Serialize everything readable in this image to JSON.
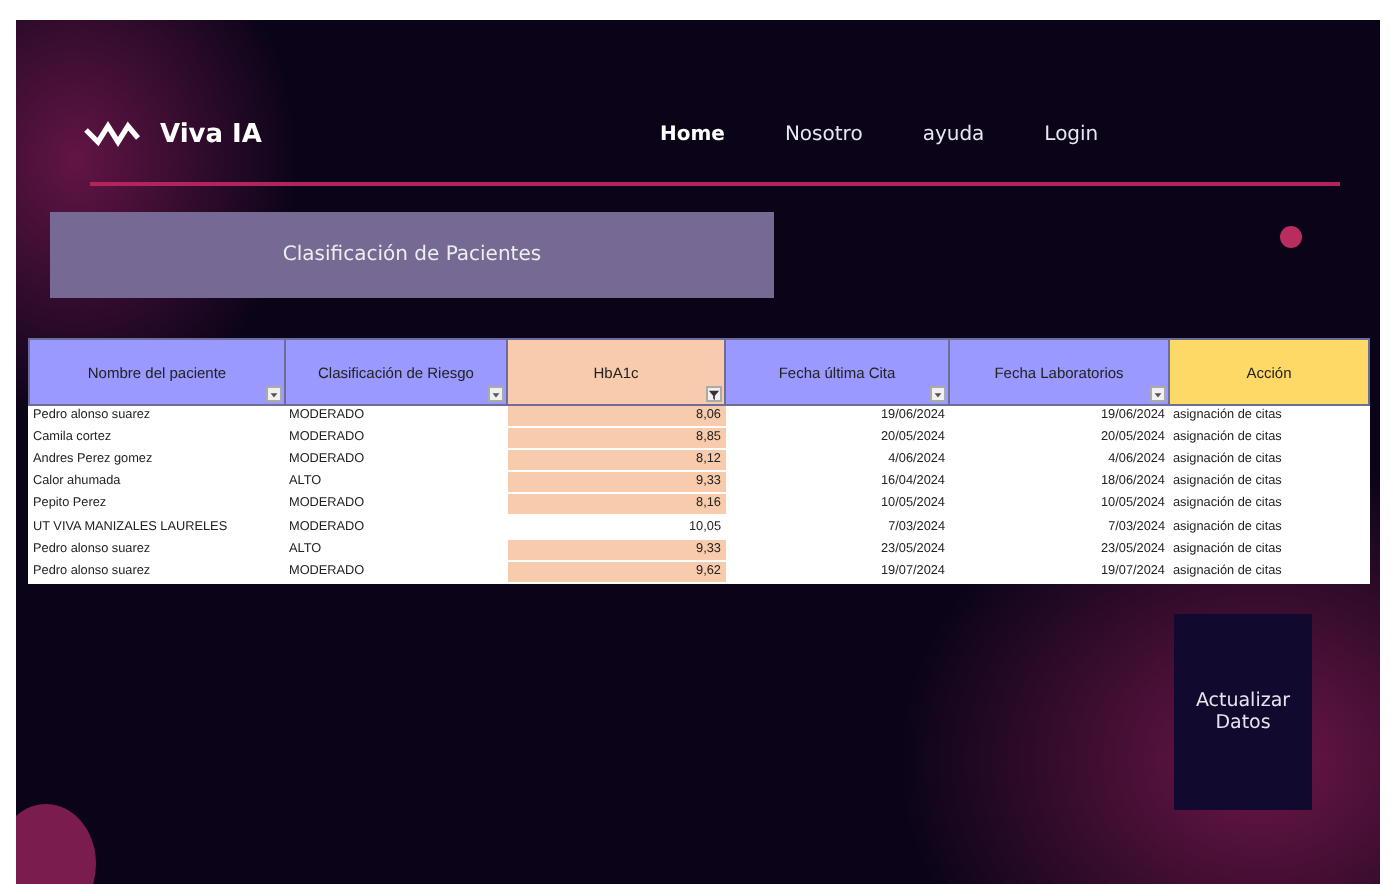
{
  "brand": {
    "name": "Viva IA"
  },
  "nav": [
    {
      "label": "Home",
      "selected": true
    },
    {
      "label": "Nosotro",
      "selected": false
    },
    {
      "label": "ayuda",
      "selected": false
    },
    {
      "label": "Login",
      "selected": false
    }
  ],
  "panel_title": "Clasificación de Pacientes",
  "table": {
    "columns": [
      {
        "label": "Nombre del paciente",
        "color": "#9999ff",
        "has_filter": true,
        "filtered": false
      },
      {
        "label": "Clasificación de Riesgo",
        "color": "#9999ff",
        "has_filter": true,
        "filtered": false
      },
      {
        "label": "HbA1c",
        "color": "#f8cbad",
        "has_filter": true,
        "filtered": true
      },
      {
        "label": "Fecha última Cita",
        "color": "#9999ff",
        "has_filter": true,
        "filtered": false
      },
      {
        "label": "Fecha Laboratorios",
        "color": "#9999ff",
        "has_filter": true,
        "filtered": false
      },
      {
        "label": "Acción",
        "color": "#ffd966",
        "has_filter": false,
        "filtered": false
      }
    ],
    "rows": [
      {
        "cells": [
          "Pedro alonso suarez",
          "MODERADO",
          "8,06",
          "19/06/2024",
          "19/06/2024",
          "asignación de citas"
        ],
        "highlighted": true
      },
      {
        "cells": [
          "Camila cortez",
          "MODERADO",
          "8,85",
          "20/05/2024",
          "20/05/2024",
          "asignación de citas"
        ],
        "highlighted": true
      },
      {
        "cells": [
          "Andres Perez gomez",
          "MODERADO",
          "8,12",
          "4/06/2024",
          "4/06/2024",
          "asignación de citas"
        ],
        "highlighted": true
      },
      {
        "cells": [
          "Calor ahumada",
          "ALTO",
          "9,33",
          "16/04/2024",
          "18/06/2024",
          "asignación de citas"
        ],
        "highlighted": true
      },
      {
        "cells": [
          "Pepito Perez",
          "MODERADO",
          "8,16",
          "10/05/2024",
          "10/05/2024",
          "asignación de citas"
        ],
        "highlighted": true
      },
      {
        "cells": [
          "UT VIVA MANIZALES LAURELES",
          "MODERADO",
          "10,05",
          "7/03/2024",
          "7/03/2024",
          "asignación de citas"
        ],
        "highlighted": false
      },
      {
        "cells": [
          "Pedro alonso suarez",
          "ALTO",
          "9,33",
          "23/05/2024",
          "23/05/2024",
          "asignación de citas"
        ],
        "highlighted": true
      },
      {
        "cells": [
          "Pedro alonso suarez",
          "MODERADO",
          "9,62",
          "19/07/2024",
          "19/07/2024",
          "asignación de citas"
        ],
        "highlighted": true
      }
    ]
  },
  "update_button": "Actualizar Datos"
}
